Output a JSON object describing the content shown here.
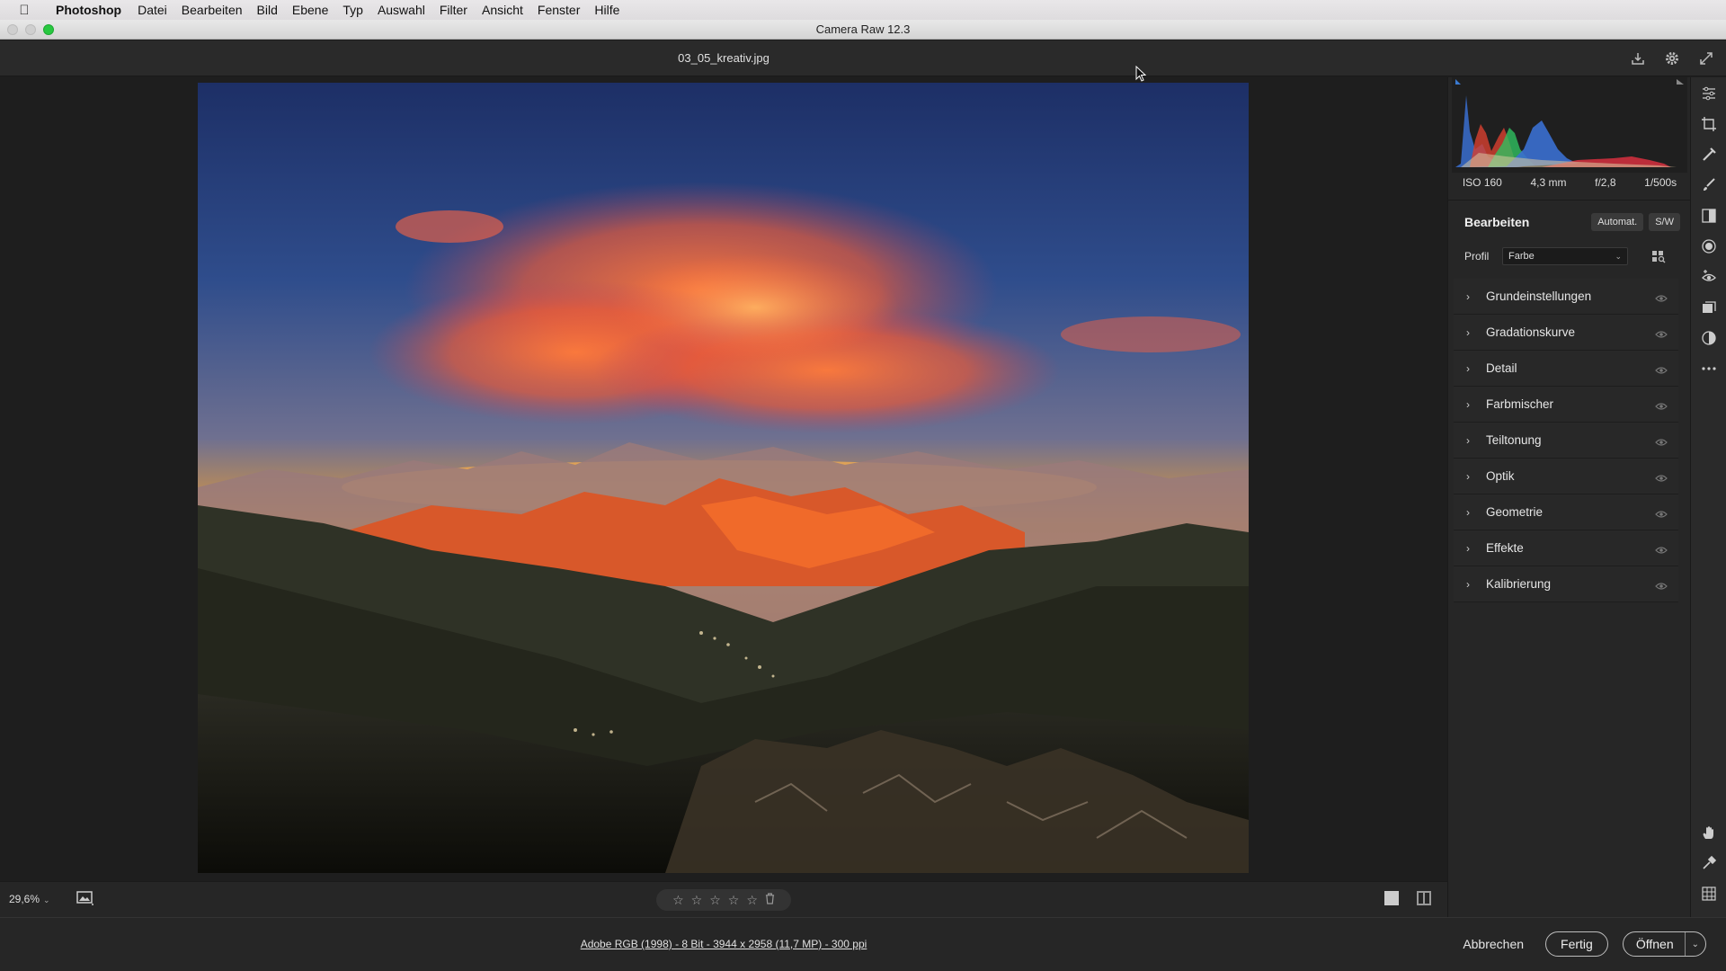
{
  "menubar": {
    "app_name": "Photoshop",
    "items": [
      "Datei",
      "Bearbeiten",
      "Bild",
      "Ebene",
      "Typ",
      "Auswahl",
      "Filter",
      "Ansicht",
      "Fenster",
      "Hilfe"
    ]
  },
  "window": {
    "title": "Camera Raw 12.3"
  },
  "document": {
    "file_name": "03_05_kreativ.jpg"
  },
  "canvas_bottom": {
    "zoom": "29,6%",
    "stars": [
      "☆",
      "☆",
      "☆",
      "☆",
      "☆"
    ],
    "trash_icon": "trash-icon"
  },
  "status": {
    "meta": "Adobe RGB (1998) - 8 Bit - 3944 x 2958 (11,7 MP) - 300 ppi",
    "cancel": "Abbrechen",
    "done": "Fertig",
    "open": "Öffnen"
  },
  "exif": {
    "iso": "ISO 160",
    "focal": "4,3 mm",
    "aperture": "f/2,8",
    "shutter": "1/500s"
  },
  "edit": {
    "title": "Bearbeiten",
    "auto": "Automat.",
    "bw": "S/W",
    "profile_label": "Profil",
    "profile_value": "Farbe"
  },
  "sections": [
    {
      "label": "Grundeinstellungen"
    },
    {
      "label": "Gradationskurve"
    },
    {
      "label": "Detail"
    },
    {
      "label": "Farbmischer"
    },
    {
      "label": "Teiltonung"
    },
    {
      "label": "Optik"
    },
    {
      "label": "Geometrie"
    },
    {
      "label": "Effekte"
    },
    {
      "label": "Kalibrierung"
    }
  ],
  "colors": {
    "accent_green": "#28c840",
    "panel_bg": "#262626",
    "canvas_bg": "#1e1e1e"
  }
}
